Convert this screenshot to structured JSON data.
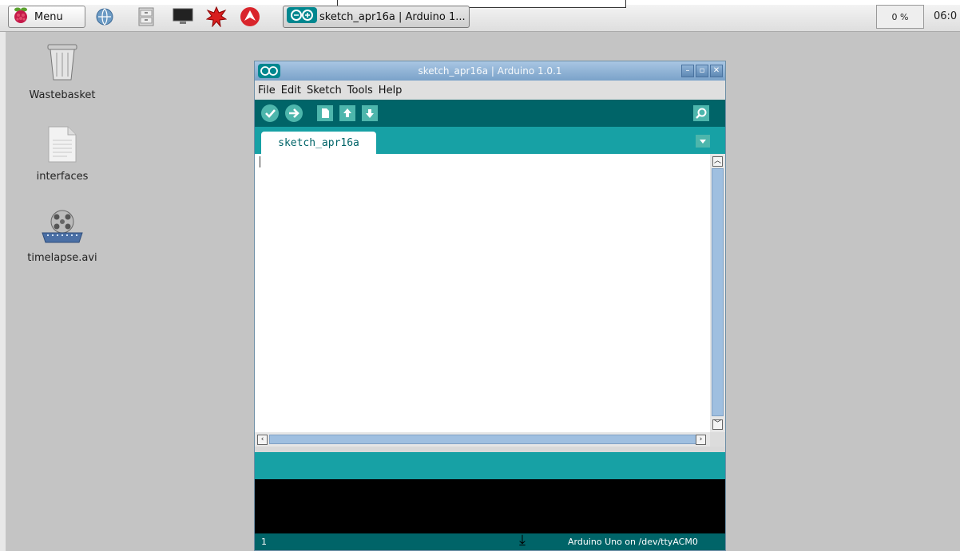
{
  "taskbar": {
    "menu_label": "Menu",
    "launchers": [
      "raspberry-icon",
      "globe-icon",
      "file-manager-icon",
      "terminal-icon",
      "burst-icon",
      "wolfram-icon"
    ],
    "task_label": "sketch_apr16a | Arduino 1...",
    "cpu": "0 %",
    "clock": "06:0"
  },
  "desktop": {
    "icons": [
      {
        "label": "Wastebasket",
        "icon": "trash-icon"
      },
      {
        "label": "interfaces",
        "icon": "text-file-icon"
      },
      {
        "label": "timelapse.avi",
        "icon": "video-file-icon"
      }
    ]
  },
  "window": {
    "title": "sketch_apr16a | Arduino 1.0.1",
    "menu": [
      "File",
      "Edit",
      "Sketch",
      "Tools",
      "Help"
    ],
    "tab": "sketch_apr16a",
    "line_number": "1",
    "board_status": "Arduino Uno on /dev/ttyACM0"
  },
  "colors": {
    "toolbar": "#006468",
    "tab_row": "#17a1a5",
    "button": "#4db6ac",
    "titlebar": "#7aa2c9"
  }
}
